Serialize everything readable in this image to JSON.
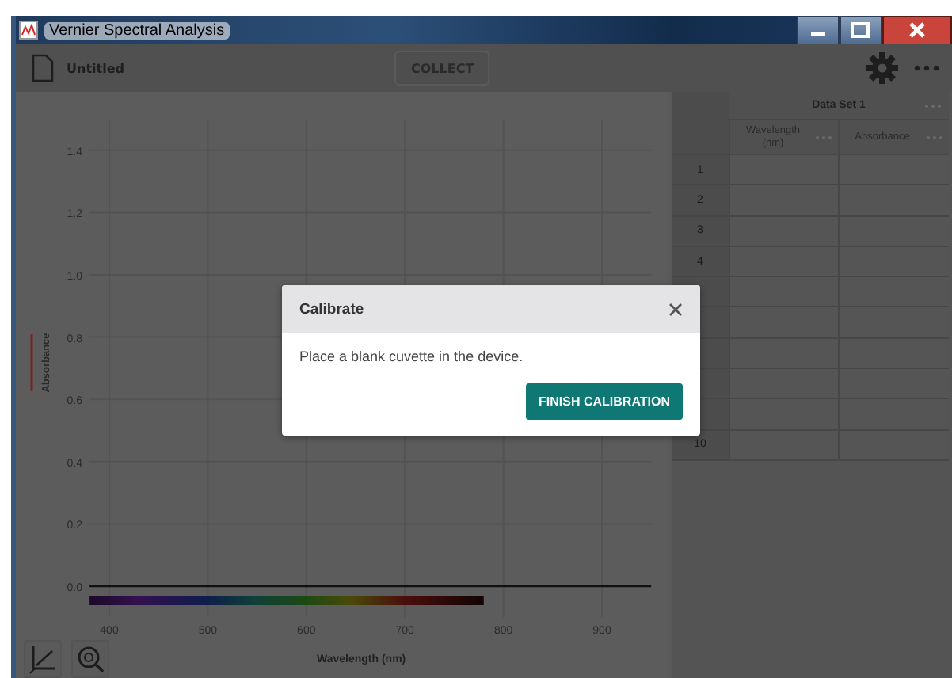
{
  "window": {
    "title": "Vernier Spectral Analysis"
  },
  "toolbar": {
    "file_name": "Untitled",
    "collect_button": {
      "label": "COLLECT",
      "disabled": true
    }
  },
  "graph": {
    "chart_data": {
      "type": "line",
      "xlabel": "Wavelength (nm)",
      "ylabel": "Absorbance",
      "grid": true,
      "xlim": [
        380,
        950
      ],
      "ylim": [
        -0.1,
        1.5
      ],
      "xticks": [
        400,
        500,
        600,
        700,
        800,
        900
      ],
      "yticks": [
        {
          "value": 0,
          "label": "0.0"
        },
        {
          "value": 0.2,
          "label": "0.2"
        },
        {
          "value": 0.4,
          "label": "0.4"
        },
        {
          "value": 0.6,
          "label": "0.6"
        },
        {
          "value": 0.8,
          "label": "0.8"
        },
        {
          "value": 1,
          "label": "1.0"
        },
        {
          "value": 1.2,
          "label": "1.2"
        },
        {
          "value": 1.4,
          "label": "1.4"
        }
      ]
    }
  },
  "table": {
    "data_set": "Data Set 1",
    "columns": [
      "Wavelength (nm)",
      "Absorbance"
    ],
    "rows": [
      {
        "number": "1"
      },
      {
        "number": "2"
      },
      {
        "number": "3"
      },
      {
        "number": "4"
      },
      {},
      {},
      {},
      {},
      {},
      {
        "number": "10"
      }
    ]
  },
  "dialog": {
    "title": "Calibrate",
    "message": "Place a blank cuvette in the device.",
    "button": "FINISH CALIBRATION"
  }
}
